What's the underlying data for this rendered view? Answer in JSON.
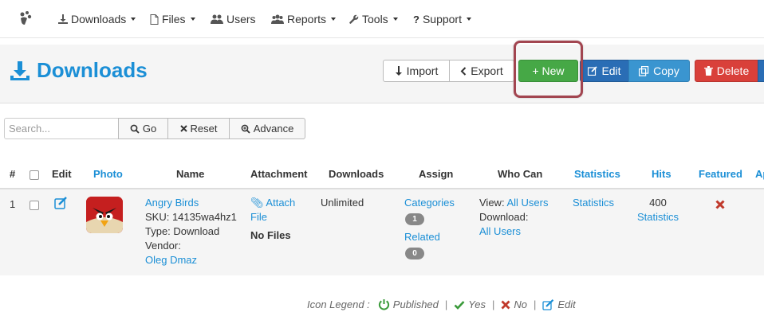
{
  "nav": {
    "items": [
      {
        "label": "Downloads",
        "icon": "download-icon",
        "dropdown": true
      },
      {
        "label": "Files",
        "icon": "file-icon",
        "dropdown": true
      },
      {
        "label": "Users",
        "icon": "users-icon",
        "dropdown": false
      },
      {
        "label": "Reports",
        "icon": "group-icon",
        "dropdown": true
      },
      {
        "label": "Tools",
        "icon": "wrench-icon",
        "dropdown": true
      },
      {
        "label": "Support",
        "icon": "question-icon",
        "dropdown": true
      }
    ]
  },
  "page": {
    "title": "Downloads"
  },
  "toolbar": {
    "import_label": "Import",
    "export_label": "Export",
    "new_label": "+ New",
    "edit_label": "Edit",
    "copy_label": "Copy",
    "delete_label": "Delete"
  },
  "search": {
    "placeholder": "Search...",
    "go_label": "Go",
    "reset_label": "Reset",
    "advance_label": "Advance"
  },
  "table": {
    "headers": {
      "num": "#",
      "edit": "Edit",
      "photo": "Photo",
      "name": "Name",
      "attachment": "Attachment",
      "downloads": "Downloads",
      "assign": "Assign",
      "who_can": "Who Can",
      "statistics": "Statistics",
      "hits": "Hits",
      "featured": "Featured",
      "truncated": "Ap"
    },
    "rows": [
      {
        "num": "1",
        "name": "Angry Birds",
        "sku": "SKU: 14135wa4hz1",
        "type": "Type: Download",
        "vendor_label": "Vendor:",
        "vendor": "Oleg Dmaz",
        "attach_label": "Attach",
        "attach_file": "File",
        "attach_status": "No Files",
        "downloads": "Unlimited",
        "categories_label": "Categories",
        "categories_count": "1",
        "related_label": "Related",
        "related_count": "0",
        "view_label": "View:",
        "view_value": "All Users",
        "download_label": "Download:",
        "download_value": "All Users",
        "statistics": "Statistics",
        "hits": "400",
        "hits_link": "Statistics",
        "featured": "no"
      }
    ]
  },
  "legend": {
    "title": "Icon Legend :",
    "published": "Published",
    "yes": "Yes",
    "no": "No",
    "edit": "Edit"
  },
  "colors": {
    "accent": "#1b8fd6",
    "new_button": "#46a846",
    "edit_button": "#2a6db5",
    "copy_button": "#3a95d0",
    "delete_button": "#d9403a",
    "highlight_ring": "#a24550"
  }
}
